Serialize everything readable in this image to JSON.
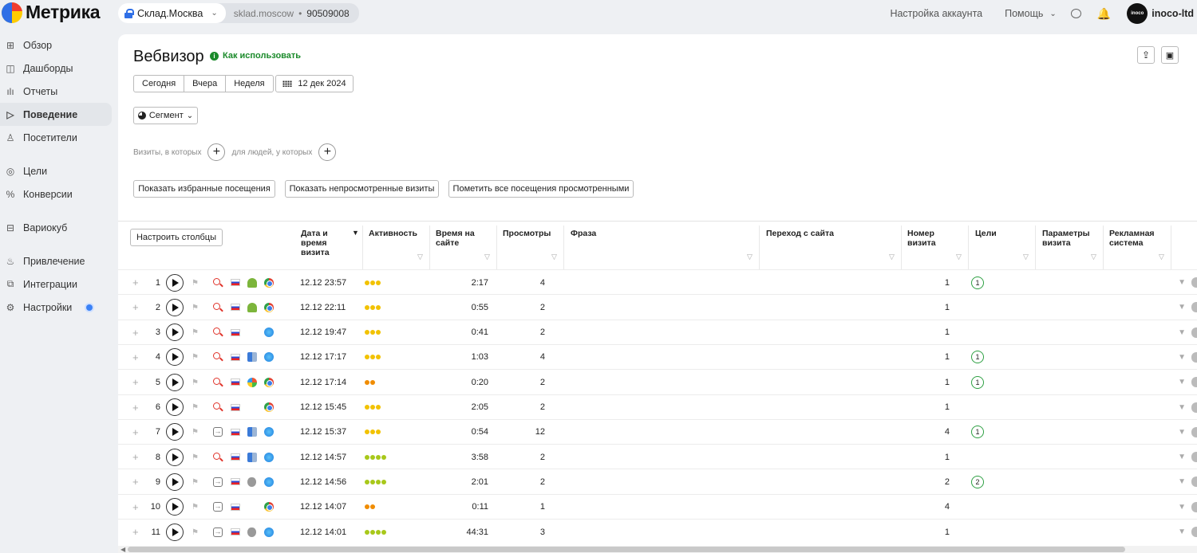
{
  "app": {
    "logo_text": "Метрика"
  },
  "counter": {
    "name": "Склад.Москва",
    "domain": "sklad.moscow",
    "separator": "•",
    "id": "90509008"
  },
  "top_nav": {
    "account_settings": "Настройка аккаунта",
    "help": "Помощь",
    "user": "inoco-ltd",
    "avatar_text": "inoco"
  },
  "sidebar": {
    "items": [
      {
        "label": "Обзор",
        "icon": "grid-icon",
        "glyph": "⊞"
      },
      {
        "label": "Дашборды",
        "icon": "dashboards-icon",
        "glyph": "◫"
      },
      {
        "label": "Отчеты",
        "icon": "reports-icon",
        "glyph": "ılı"
      },
      {
        "label": "Поведение",
        "icon": "play-outline-icon",
        "glyph": "▷"
      },
      {
        "label": "Посетители",
        "icon": "user-icon",
        "glyph": "♙"
      },
      {
        "label": "Цели",
        "icon": "target-icon",
        "glyph": "◎"
      },
      {
        "label": "Конверсии",
        "icon": "percent-icon",
        "glyph": "%"
      },
      {
        "label": "Вариокуб",
        "icon": "variocube-icon",
        "glyph": "⊟"
      },
      {
        "label": "Привлечение",
        "icon": "flame-icon",
        "glyph": "♨"
      },
      {
        "label": "Интеграции",
        "icon": "integrations-icon",
        "glyph": "⧉"
      },
      {
        "label": "Настройки",
        "icon": "gear-icon",
        "glyph": "⚙"
      }
    ]
  },
  "page": {
    "title": "Вебвизор",
    "howto": "Как использовать",
    "periods": [
      "Сегодня",
      "Вчера",
      "Неделя"
    ],
    "date": "12 дек 2024",
    "segment": "Сегмент",
    "filter_visits": "Визиты, в которых",
    "filter_people": "для людей, у которых",
    "actions": [
      "Показать избранные посещения",
      "Показать непросмотренные визиты",
      "Пометить все посещения просмотренными"
    ],
    "configure_columns": "Настроить столбцы"
  },
  "table": {
    "columns": [
      "Дата и время визита",
      "Активность",
      "Время на сайте",
      "Просмотры",
      "Фраза",
      "Переход с сайта",
      "Номер визита",
      "Цели",
      "Параметры визита",
      "Рекламная система"
    ],
    "rows": [
      {
        "n": "1",
        "source": "search",
        "os": "android",
        "browser": "chrome",
        "date": "12.12 23:57",
        "activity": 3,
        "act_color": "#f2c200",
        "time": "2:17",
        "views": "4",
        "visit_no": "1",
        "goals": "1"
      },
      {
        "n": "2",
        "source": "search",
        "os": "android",
        "browser": "chrome",
        "date": "12.12 22:11",
        "activity": 3,
        "act_color": "#f2c200",
        "time": "0:55",
        "views": "2",
        "visit_no": "1",
        "goals": ""
      },
      {
        "n": "3",
        "source": "search",
        "os": "none",
        "browser": "safari",
        "date": "12.12 19:47",
        "activity": 3,
        "act_color": "#f2c200",
        "time": "0:41",
        "views": "2",
        "visit_no": "1",
        "goals": ""
      },
      {
        "n": "4",
        "source": "search",
        "os": "mac",
        "browser": "safari",
        "date": "12.12 17:17",
        "activity": 3,
        "act_color": "#f2c200",
        "time": "1:03",
        "views": "4",
        "visit_no": "1",
        "goals": "1"
      },
      {
        "n": "5",
        "source": "search",
        "os": "winxp",
        "browser": "chrome",
        "date": "12.12 17:14",
        "activity": 2,
        "act_color": "#f08c00",
        "time": "0:20",
        "views": "2",
        "visit_no": "1",
        "goals": "1"
      },
      {
        "n": "6",
        "source": "search",
        "os": "windows",
        "browser": "chrome",
        "date": "12.12 15:45",
        "activity": 3,
        "act_color": "#f2c200",
        "time": "2:05",
        "views": "2",
        "visit_no": "1",
        "goals": ""
      },
      {
        "n": "7",
        "source": "direct",
        "os": "mac",
        "browser": "safari",
        "date": "12.12 15:37",
        "activity": 3,
        "act_color": "#f2c200",
        "time": "0:54",
        "views": "12",
        "visit_no": "4",
        "goals": "1"
      },
      {
        "n": "8",
        "source": "search",
        "os": "mac",
        "browser": "safari",
        "date": "12.12 14:57",
        "activity": 4,
        "act_color": "#a8c81a",
        "time": "3:58",
        "views": "2",
        "visit_no": "1",
        "goals": ""
      },
      {
        "n": "9",
        "source": "direct",
        "os": "apple",
        "browser": "safari",
        "date": "12.12 14:56",
        "activity": 4,
        "act_color": "#a8c81a",
        "time": "2:01",
        "views": "2",
        "visit_no": "2",
        "goals": "2"
      },
      {
        "n": "10",
        "source": "direct",
        "os": "windows",
        "browser": "chrome",
        "date": "12.12 14:07",
        "activity": 2,
        "act_color": "#f08c00",
        "time": "0:11",
        "views": "1",
        "visit_no": "4",
        "goals": ""
      },
      {
        "n": "11",
        "source": "direct",
        "os": "apple",
        "browser": "safari",
        "date": "12.12 14:01",
        "activity": 4,
        "act_color": "#a8c81a",
        "time": "44:31",
        "views": "3",
        "visit_no": "1",
        "goals": ""
      }
    ]
  }
}
